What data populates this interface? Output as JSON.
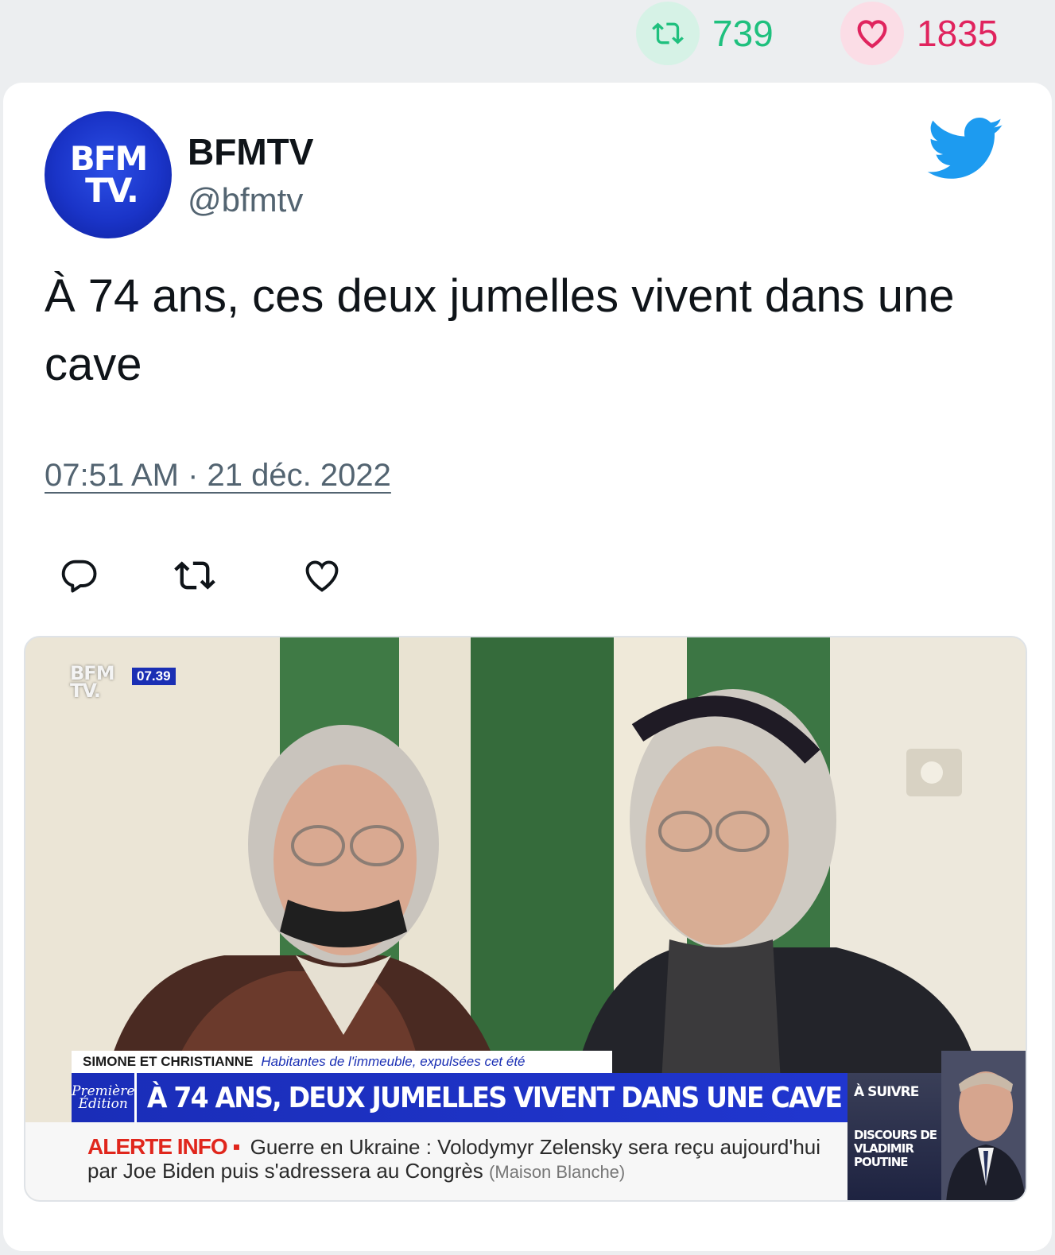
{
  "stats": {
    "retweets": "739",
    "likes": "1835",
    "retweet_color": "#1fc07e",
    "like_color": "#e0245e"
  },
  "author": {
    "name": "BFMTV",
    "handle": "@bfmtv",
    "avatar_icon": "bfmtv-logo"
  },
  "tweet": {
    "text": "À 74 ans, ces deux jumelles vivent dans une cave",
    "timestamp": "07:51 AM · 21 déc. 2022"
  },
  "actions": {
    "reply_icon": "reply-icon",
    "retweet_icon": "retweet-icon",
    "like_icon": "heart-icon"
  },
  "media": {
    "tv_logo_line1": "BFM",
    "tv_logo_line2": "TV.",
    "tv_time": "07.39",
    "names": "SIMONE ET CHRISTIANNE",
    "names_desc": "Habitantes de l'immeuble, expulsées cet été",
    "edition_line1": "Première",
    "edition_line2": "Édition",
    "headline": "À 74 ANS, DEUX JUMELLES VIVENT DANS UNE CAVE",
    "alert_label": "ALERTE INFO ▪",
    "alert_text": "Guerre en Ukraine : Volodymyr Zelensky sera reçu aujourd'hui par Joe Biden puis s'adressera au Congrès",
    "alert_source": "(Maison Blanche)",
    "next_label": "À SUIVRE",
    "next_title": "DISCOURS DE VLADIMIR POUTINE"
  },
  "colors": {
    "brand_blue": "#1a2fb4",
    "twitter_blue": "#1d9bf0"
  }
}
